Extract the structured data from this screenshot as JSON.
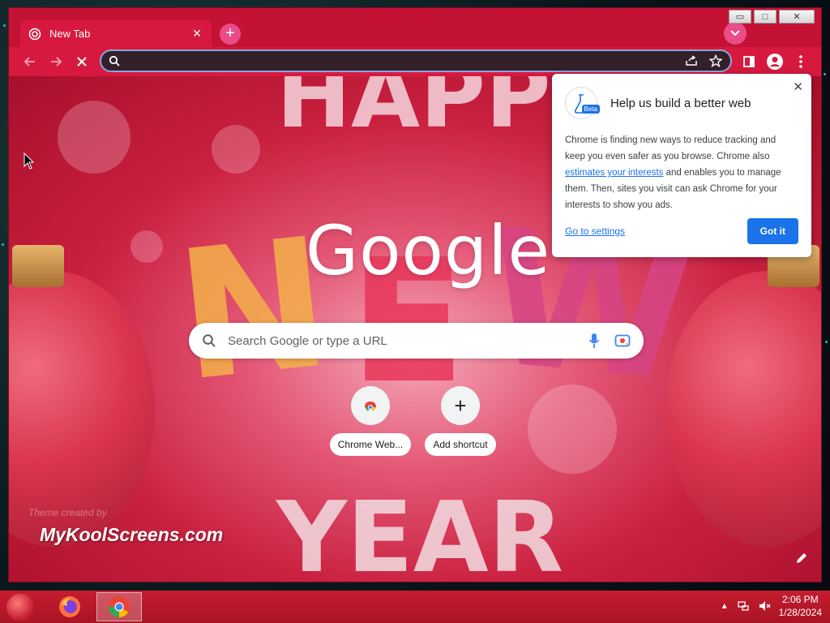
{
  "browser": {
    "tab_title": "New Tab",
    "tab_close": "✕",
    "new_tab": "+",
    "window_controls": {
      "minimize": "▭",
      "maximize": "□",
      "close": "✕"
    }
  },
  "omnibox": {
    "value": ""
  },
  "ntp": {
    "logo": "Google",
    "search_placeholder": "Search Google or type a URL",
    "shortcuts": [
      {
        "label": "Chrome Web...",
        "icon": "chrome-web-store-icon"
      },
      {
        "label": "Add shortcut",
        "icon": "plus-icon"
      }
    ],
    "theme_credit": "Theme created by",
    "watermark": "MyKoolScreens.com"
  },
  "popup": {
    "title": "Help us build a better web",
    "badge": "Beta",
    "body_before_link": "Chrome is finding new ways to reduce tracking and keep you even safer as you browse. Chrome also ",
    "body_link": "estimates your interests",
    "body_after_link": " and enables you to manage them. Then, sites you visit can ask Chrome for your interests to show you ads.",
    "settings_link": "Go to settings",
    "confirm_button": "Got it"
  },
  "taskbar": {
    "time": "2:06 PM",
    "date": "1/28/2024"
  },
  "colors": {
    "chrome_theme": "#d8193f",
    "accent_blue": "#1a73e8"
  }
}
